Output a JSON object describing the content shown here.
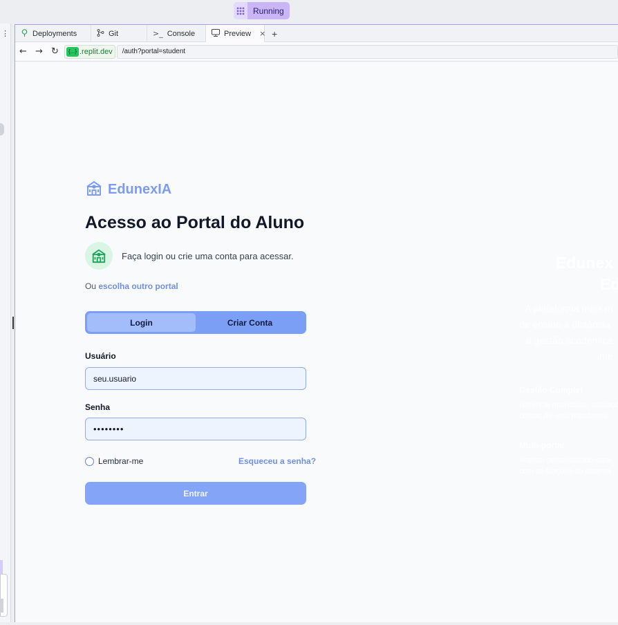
{
  "topbar": {
    "status": "Running"
  },
  "tabs": [
    {
      "label": "Deployments",
      "icon": "deployments-icon"
    },
    {
      "label": "Git",
      "icon": "git-icon"
    },
    {
      "label": "Console",
      "icon": "console-icon"
    },
    {
      "label": "Preview",
      "icon": "preview-icon"
    }
  ],
  "urlbar": {
    "host": ".replit.dev",
    "host_prefix": "{...}",
    "path": "/auth?portal=student"
  },
  "brand": {
    "name": "EdunexIA"
  },
  "main": {
    "title": "Acesso ao Portal do Aluno",
    "hint": "Faça login ou crie uma conta para acessar.",
    "portal_prefix": "Ou",
    "portal_link": "escolha outro portal"
  },
  "auth_tabs": {
    "login": "Login",
    "register": "Criar Conta",
    "active": "login"
  },
  "form": {
    "username_label": "Usuário",
    "username_value": "seu.usuario",
    "password_label": "Senha",
    "password_value": "••••••••",
    "remember_label": "Lembrar-me",
    "forgot_label": "Esqueceu a senha?",
    "submit_label": "Entrar"
  },
  "side_panel": {
    "heading_line1": "Edunex",
    "heading_line2": "Ed",
    "desc_lines": [
      "A plataforma mais m",
      "de ensino a distância",
      "a gestão acadêmica",
      "inte"
    ],
    "feature1_title": "Gestão Complet",
    "feature1_lines": [
      "Gerencie matrículas, avaliaçõ",
      "cursos de uma plataforma."
    ],
    "feature2_title": "Multi-portal",
    "feature2_lines": [
      "Acesso personalizado para",
      "com as funções do sistema"
    ]
  },
  "colors": {
    "accent": "#7b9ff5",
    "brand": "#7b9cf0",
    "running": "#c8b6f7",
    "hint_bg": "#d9f5e4"
  }
}
